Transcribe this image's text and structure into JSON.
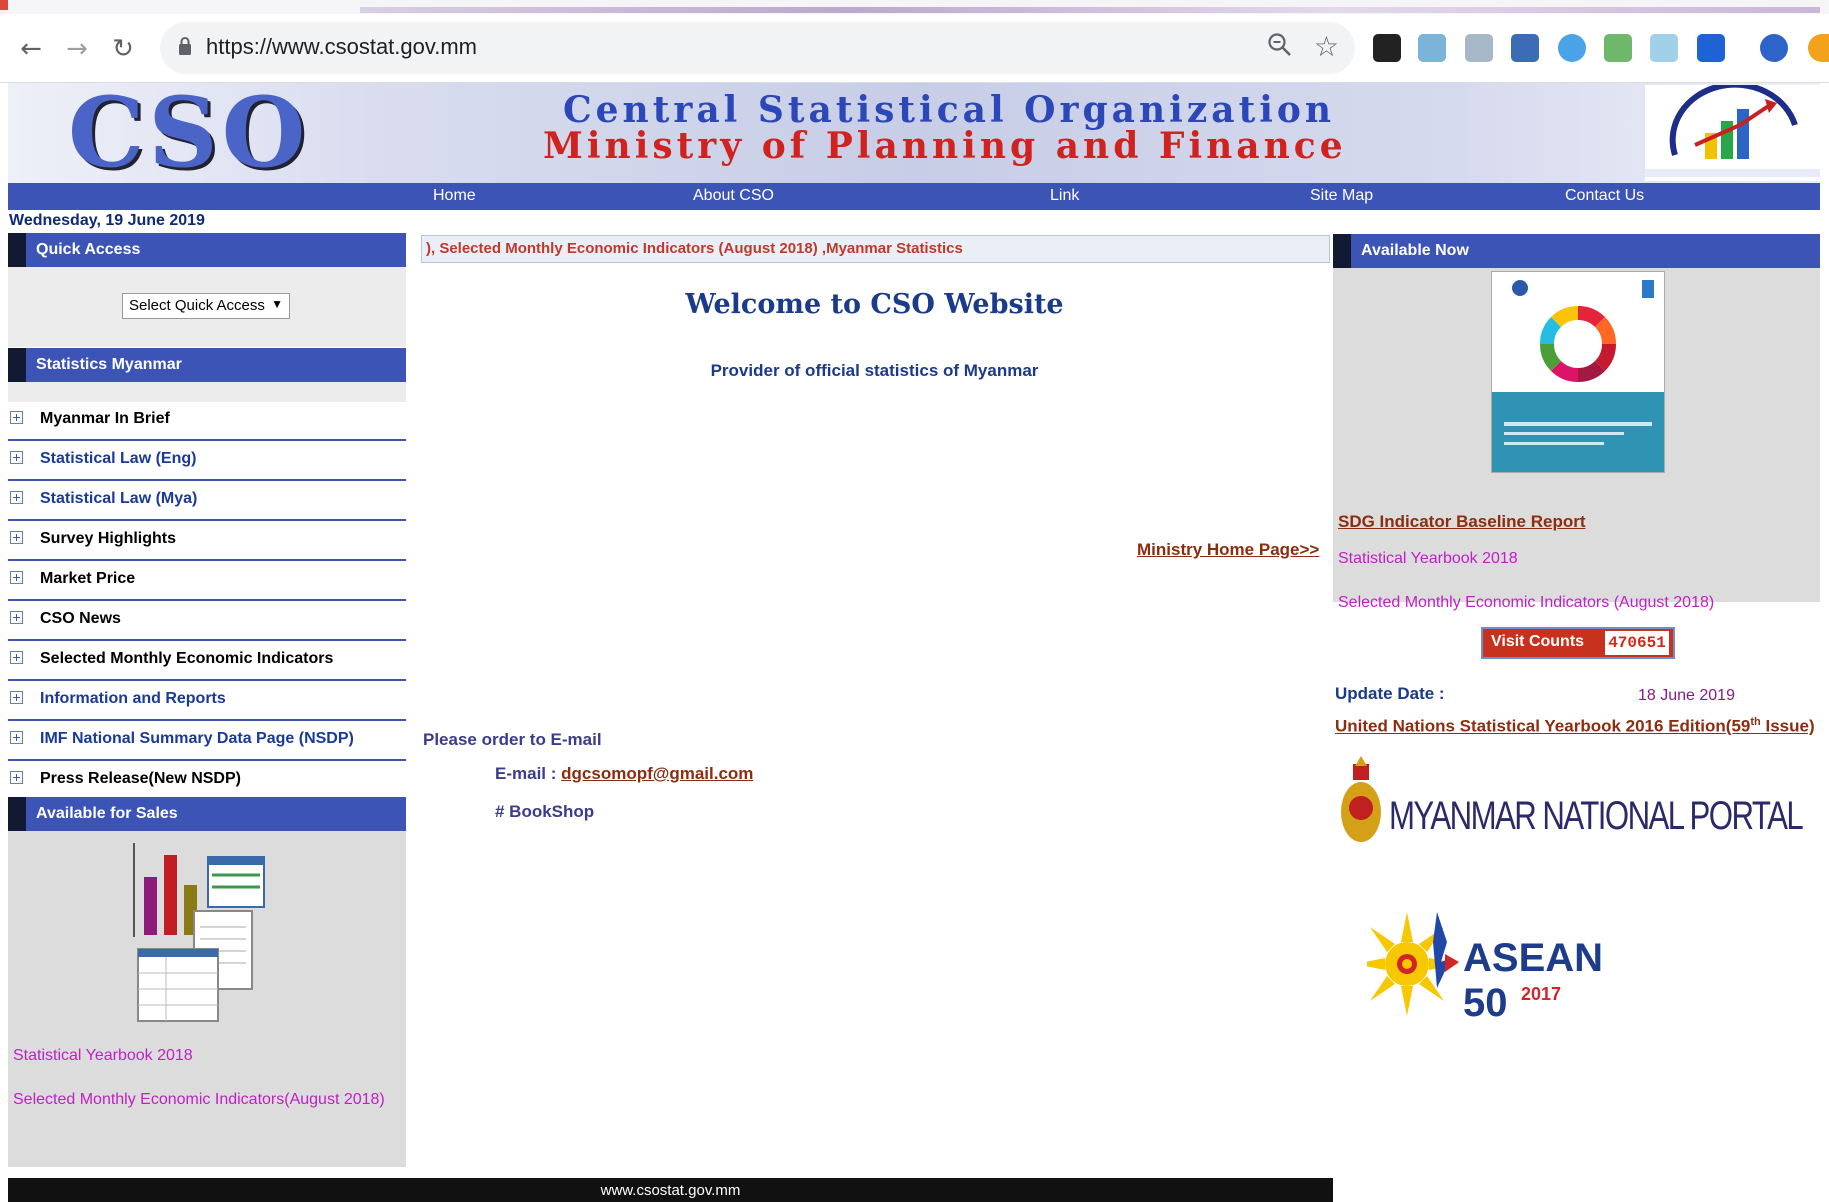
{
  "browser": {
    "url": "https://www.csostat.gov.mm",
    "icons": [
      "back-icon",
      "forward-icon",
      "reload-icon",
      "lock-icon",
      "zoom-icon",
      "star-icon"
    ]
  },
  "banner": {
    "logo": "CSO",
    "line1": "Central Statistical Organization",
    "line2": "Ministry of Planning and Finance"
  },
  "nav": {
    "items": [
      "Home",
      "About CSO",
      "Link",
      "Site Map",
      "Contact Us"
    ]
  },
  "date": "Wednesday, 19 June 2019",
  "left": {
    "quick_access_title": "Quick Access",
    "quick_access_select": "Select Quick Access",
    "stats_title": "Statistics Myanmar",
    "stats_items": [
      {
        "label": "Myanmar In Brief",
        "color": "#000000"
      },
      {
        "label": "Statistical Law (Eng)",
        "color": "#1a3a9a"
      },
      {
        "label": "Statistical Law (Mya)",
        "color": "#1a3a9a"
      },
      {
        "label": "Survey Highlights",
        "color": "#000000"
      },
      {
        "label": "Market Price",
        "color": "#000000"
      },
      {
        "label": "CSO News",
        "color": "#000000"
      },
      {
        "label": "Selected Monthly Economic Indicators",
        "color": "#000000"
      },
      {
        "label": "Information and Reports",
        "color": "#1a3a9a"
      },
      {
        "label": "IMF National Summary Data Page (NSDP)",
        "color": "#1a3a9a"
      },
      {
        "label": "Press Release(New NSDP)",
        "color": "#000000"
      }
    ],
    "sales_title": "Available for Sales",
    "sales_links": [
      "Statistical Yearbook 2018",
      "Selected Monthly Economic Indicators(August 2018)"
    ]
  },
  "center": {
    "marquee": "), Selected Monthly Economic Indicators (August 2018) ,Myanmar Statistics",
    "welcome": "Welcome to CSO Website",
    "provider": "Provider of official statistics of Myanmar",
    "ministry_link": "Ministry Home Page>>",
    "order_text": "Please order to E-mail",
    "email_label": "E-mail :",
    "email": "dgcsomopf@gmail.com",
    "bookshop": "# BookShop"
  },
  "right": {
    "available_title": "Available Now",
    "sdg_link": "SDG Indicator Baseline Report",
    "links": [
      "Statistical Yearbook 2018",
      "Selected Monthly Economic Indicators (August 2018)"
    ],
    "visit_label": "Visit Counts",
    "visit_count": "470651",
    "update_label": "Update Date :",
    "update_value": "18 June 2019",
    "un_link_pre": "United Nations Statistical Yearbook 2016 Edition(59",
    "un_link_sup": "th",
    "un_link_post": " Issue)",
    "portal_text": "MYANMAR NATIONAL PORTAL",
    "asean_text": "ASEAN 50",
    "asean_year": "2017"
  },
  "footer": "www.csostat.gov.mm"
}
